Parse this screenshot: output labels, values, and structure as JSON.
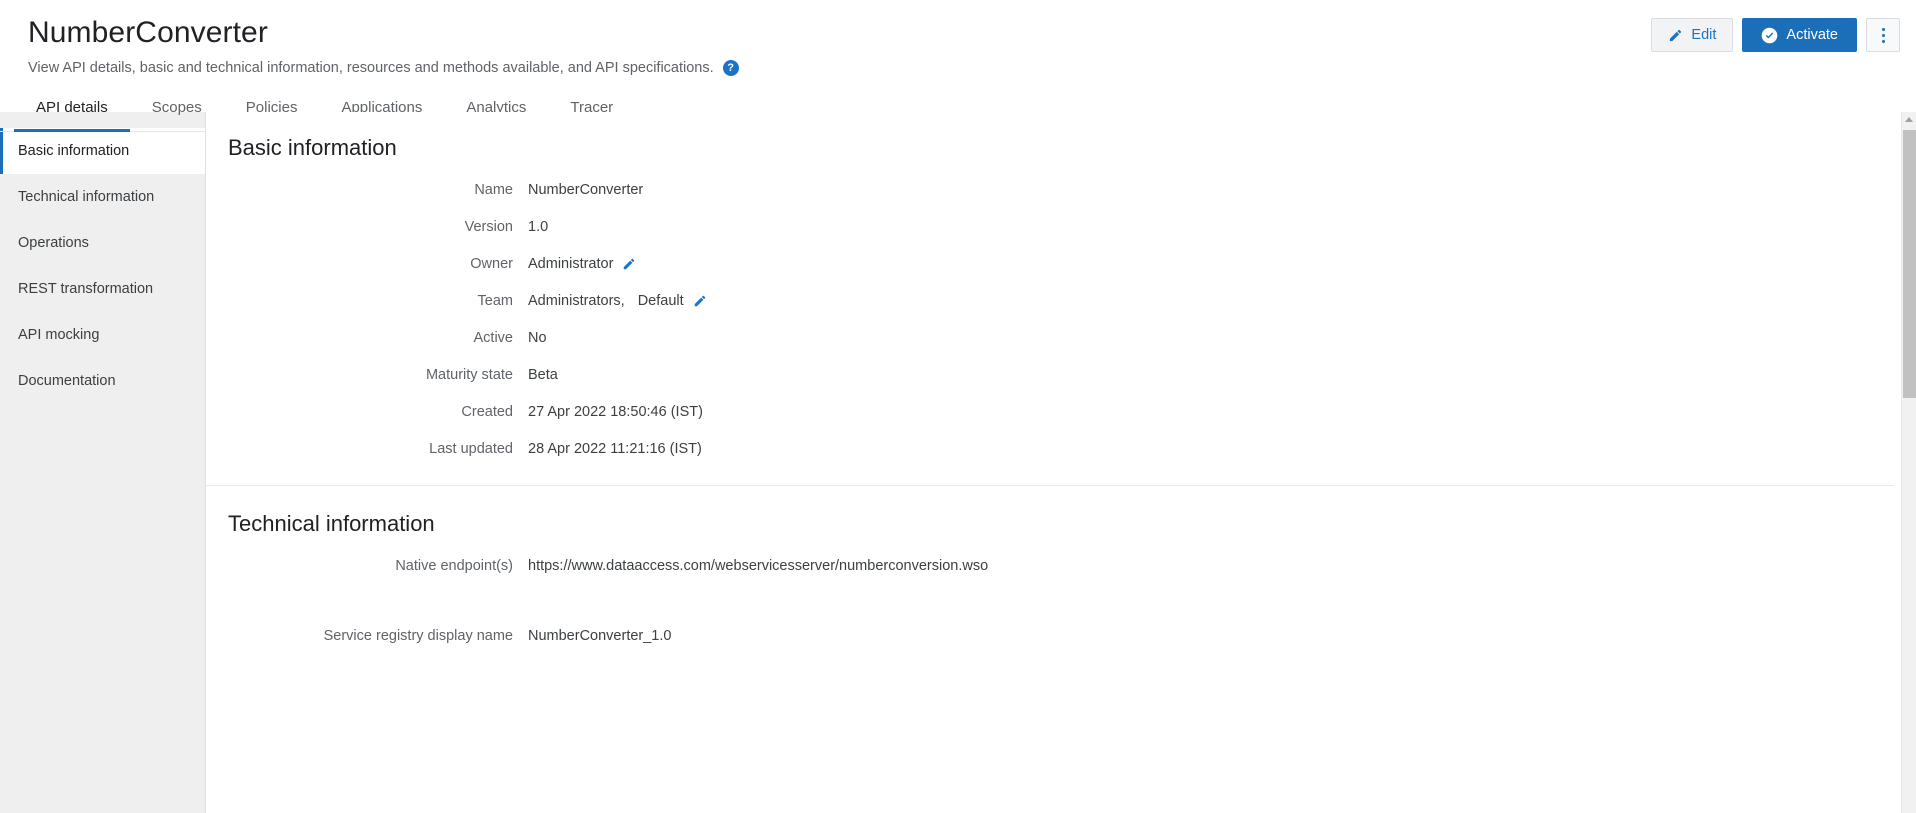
{
  "header": {
    "title": "NumberConverter",
    "subtitle": "View API details, basic and technical information, resources and methods available, and API specifications.",
    "help_icon": "help-circle-icon",
    "help_glyph": "?",
    "actions": {
      "edit_label": "Edit",
      "edit_icon": "pencil-icon",
      "activate_label": "Activate",
      "activate_icon": "check-circle-icon",
      "more_label": "More options",
      "more_icon": "kebab-menu-icon"
    }
  },
  "tabs": [
    {
      "label": "API details",
      "active": true
    },
    {
      "label": "Scopes",
      "active": false
    },
    {
      "label": "Policies",
      "active": false
    },
    {
      "label": "Applications",
      "active": false
    },
    {
      "label": "Analytics",
      "active": false
    },
    {
      "label": "Tracer",
      "active": false
    }
  ],
  "sidebar": {
    "items": [
      {
        "label": "Basic information",
        "active": true
      },
      {
        "label": "Technical information",
        "active": false
      },
      {
        "label": "Operations",
        "active": false
      },
      {
        "label": "REST transformation",
        "active": false
      },
      {
        "label": "API mocking",
        "active": false
      },
      {
        "label": "Documentation",
        "active": false
      }
    ]
  },
  "main": {
    "basic": {
      "title": "Basic information",
      "rows": [
        {
          "label": "Name",
          "value": "NumberConverter"
        },
        {
          "label": "Version",
          "value": "1.0"
        },
        {
          "label": "Owner",
          "value": "Administrator",
          "edit_icon": "pencil-icon"
        },
        {
          "label": "Team",
          "value": "Administrators,",
          "value2": "Default",
          "edit_icon": "pencil-icon"
        },
        {
          "label": "Active",
          "value": "No"
        },
        {
          "label": "Maturity state",
          "value": "Beta"
        },
        {
          "label": "Created",
          "value": "27 Apr 2022 18:50:46 (IST)"
        },
        {
          "label": "Last updated",
          "value": "28 Apr 2022 11:21:16 (IST)"
        }
      ]
    },
    "technical": {
      "title": "Technical information",
      "rows": [
        {
          "label": "Native endpoint(s)",
          "value": "https://www.dataaccess.com/webservicesserver/numberconversion.wso"
        },
        {
          "label": "Service registry display name",
          "value": "NumberConverter_1.0"
        }
      ]
    }
  },
  "scrollbar": {
    "name": "vertical-scrollbar",
    "up_arrow": "scroll-up-arrow-icon"
  },
  "colors": {
    "accent": "#1b6fb8",
    "link": "#1a73c8",
    "sidebar_bg": "#efefef",
    "text": "#3c4043",
    "muted": "#5f6368"
  }
}
